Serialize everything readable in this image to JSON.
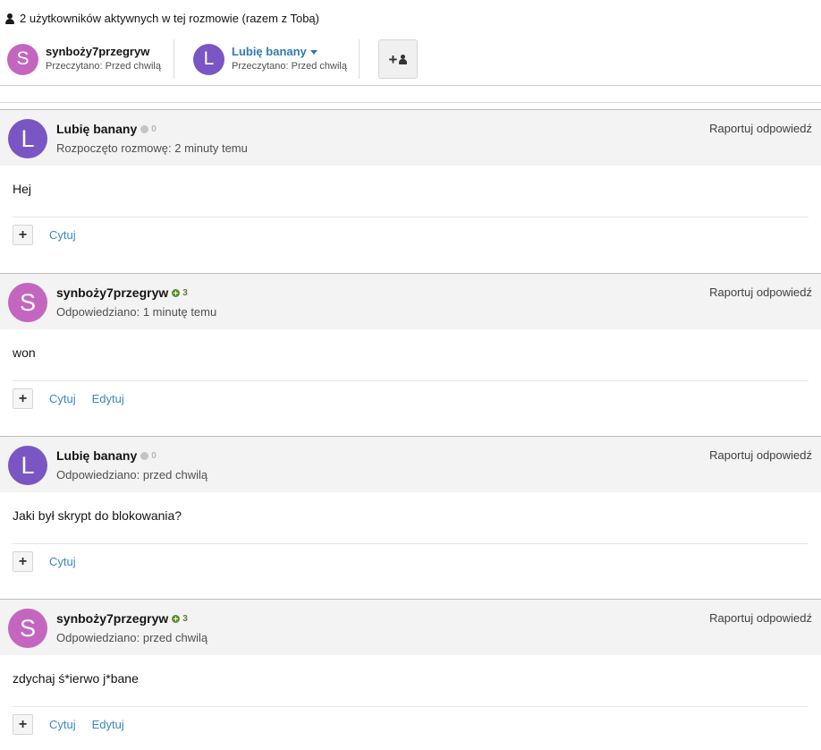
{
  "header": {
    "active_users_text": "2 użytkowników aktywnych w tej rozmowie (razem z Tobą)",
    "user_icon": "user-icon"
  },
  "participants": [
    {
      "initial": "S",
      "name": "synboży7przegryw",
      "read": "Przeczytano: Przed chwilą",
      "color": "#c466c0"
    },
    {
      "initial": "L",
      "name": "Lubię banany",
      "read": "Przeczytano: Przed chwilą",
      "color": "#7a55c4"
    }
  ],
  "add_participant": {
    "icon": "add-user-icon",
    "plus": "+"
  },
  "posts": [
    {
      "initial": "L",
      "author": "Lubię banany",
      "reputation": "0",
      "rep_type": "neutral",
      "meta": "Rozpoczęto rozmowę: 2 minuty temu",
      "body": "Hej",
      "report": "Raportuj odpowiedź",
      "actions": [
        "Cytuj"
      ],
      "color": "#7a55c4"
    },
    {
      "initial": "S",
      "author": "synboży7przegryw",
      "reputation": "3",
      "rep_type": "positive",
      "meta": "Odpowiedziano: 1 minutę temu",
      "body": "won",
      "report": "Raportuj odpowiedź",
      "actions": [
        "Cytuj",
        "Edytuj"
      ],
      "color": "#c466c0"
    },
    {
      "initial": "L",
      "author": "Lubię banany",
      "reputation": "0",
      "rep_type": "neutral",
      "meta": "Odpowiedziano: przed chwilą",
      "body": "Jaki był skrypt do blokowania?",
      "report": "Raportuj odpowiedź",
      "actions": [
        "Cytuj"
      ],
      "color": "#7a55c4"
    },
    {
      "initial": "S",
      "author": "synboży7przegryw",
      "reputation": "3",
      "rep_type": "positive",
      "meta": "Odpowiedziano: przed chwilą",
      "body": "zdychaj ś*ierwo j*bane",
      "report": "Raportuj odpowiedź",
      "actions": [
        "Cytuj",
        "Edytuj"
      ],
      "color": "#c466c0"
    }
  ],
  "plus_label": "+"
}
